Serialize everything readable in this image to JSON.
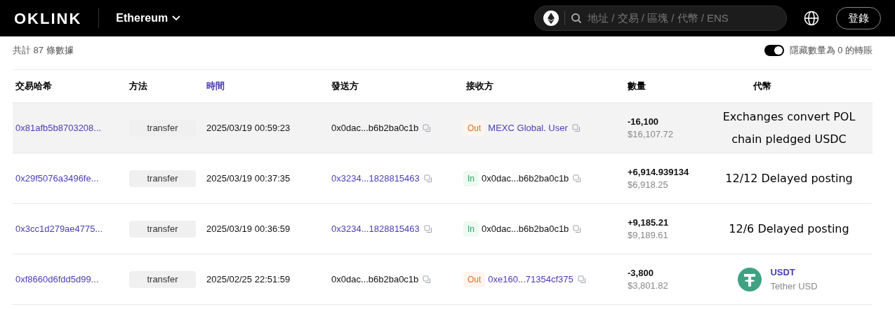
{
  "header": {
    "logo": "OKLINK",
    "network": "Ethereum",
    "search": {
      "placeholder": "地址 / 交易 / 區塊 / 代幣 / ENS"
    },
    "login": "登錄"
  },
  "summary": {
    "total": "共計 87 條數據",
    "hide_zero": {
      "label": "隱藏數量為 0 的轉賬",
      "on": true
    }
  },
  "table": {
    "columns": [
      {
        "label": "交易哈希",
        "sortable": false
      },
      {
        "label": "方法",
        "sortable": false
      },
      {
        "label": "時間",
        "sortable": true
      },
      {
        "label": "發送方",
        "sortable": false
      },
      {
        "label": "接收方",
        "sortable": false
      },
      {
        "label": "數量",
        "sortable": false
      },
      {
        "label": "代幣",
        "sortable": false
      }
    ],
    "rows": [
      {
        "selected": true,
        "hash": "0x81afb5b8703208...",
        "method": "transfer",
        "time": "2025/03/19 00:59:23",
        "from": {
          "address": "0x0dac...b6b2ba0c1b",
          "link": false
        },
        "direction": {
          "kind": "out",
          "label": "Out"
        },
        "to": {
          "address": "MEXC Global. User",
          "link": true
        },
        "amount": "-16,100",
        "value": "$16,107.72",
        "token": {
          "kind": "note",
          "lines": [
            "Exchanges convert POL",
            "chain pledged USDC"
          ]
        }
      },
      {
        "selected": false,
        "hash": "0x29f5076a3496fe...",
        "method": "transfer",
        "time": "2025/03/19 00:37:35",
        "from": {
          "address": "0x3234...1828815463",
          "link": true
        },
        "direction": {
          "kind": "in",
          "label": "In"
        },
        "to": {
          "address": "0x0dac...b6b2ba0c1b",
          "link": false
        },
        "amount": "+6,914.939134",
        "value": "$6,918.25",
        "token": {
          "kind": "note",
          "lines": [
            "12/12 Delayed posting"
          ]
        }
      },
      {
        "selected": false,
        "hash": "0x3cc1d279ae4775...",
        "method": "transfer",
        "time": "2025/03/19 00:36:59",
        "from": {
          "address": "0x3234...1828815463",
          "link": true
        },
        "direction": {
          "kind": "in",
          "label": "In"
        },
        "to": {
          "address": "0x0dac...b6b2ba0c1b",
          "link": false
        },
        "amount": "+9,185.21",
        "value": "$9,189.61",
        "token": {
          "kind": "note",
          "lines": [
            "12/6 Delayed posting"
          ]
        }
      },
      {
        "selected": false,
        "hash": "0xf8660d6fdd5d99...",
        "method": "transfer",
        "time": "2025/02/25 22:51:59",
        "from": {
          "address": "0x0dac...b6b2ba0c1b",
          "link": false
        },
        "direction": {
          "kind": "out",
          "label": "Out"
        },
        "to": {
          "address": "0xe160...71354cf375",
          "link": true
        },
        "amount": "-3,800",
        "value": "$3,801.82",
        "token": {
          "kind": "token",
          "symbol": "USDT",
          "name": "Tether USD"
        }
      }
    ]
  }
}
